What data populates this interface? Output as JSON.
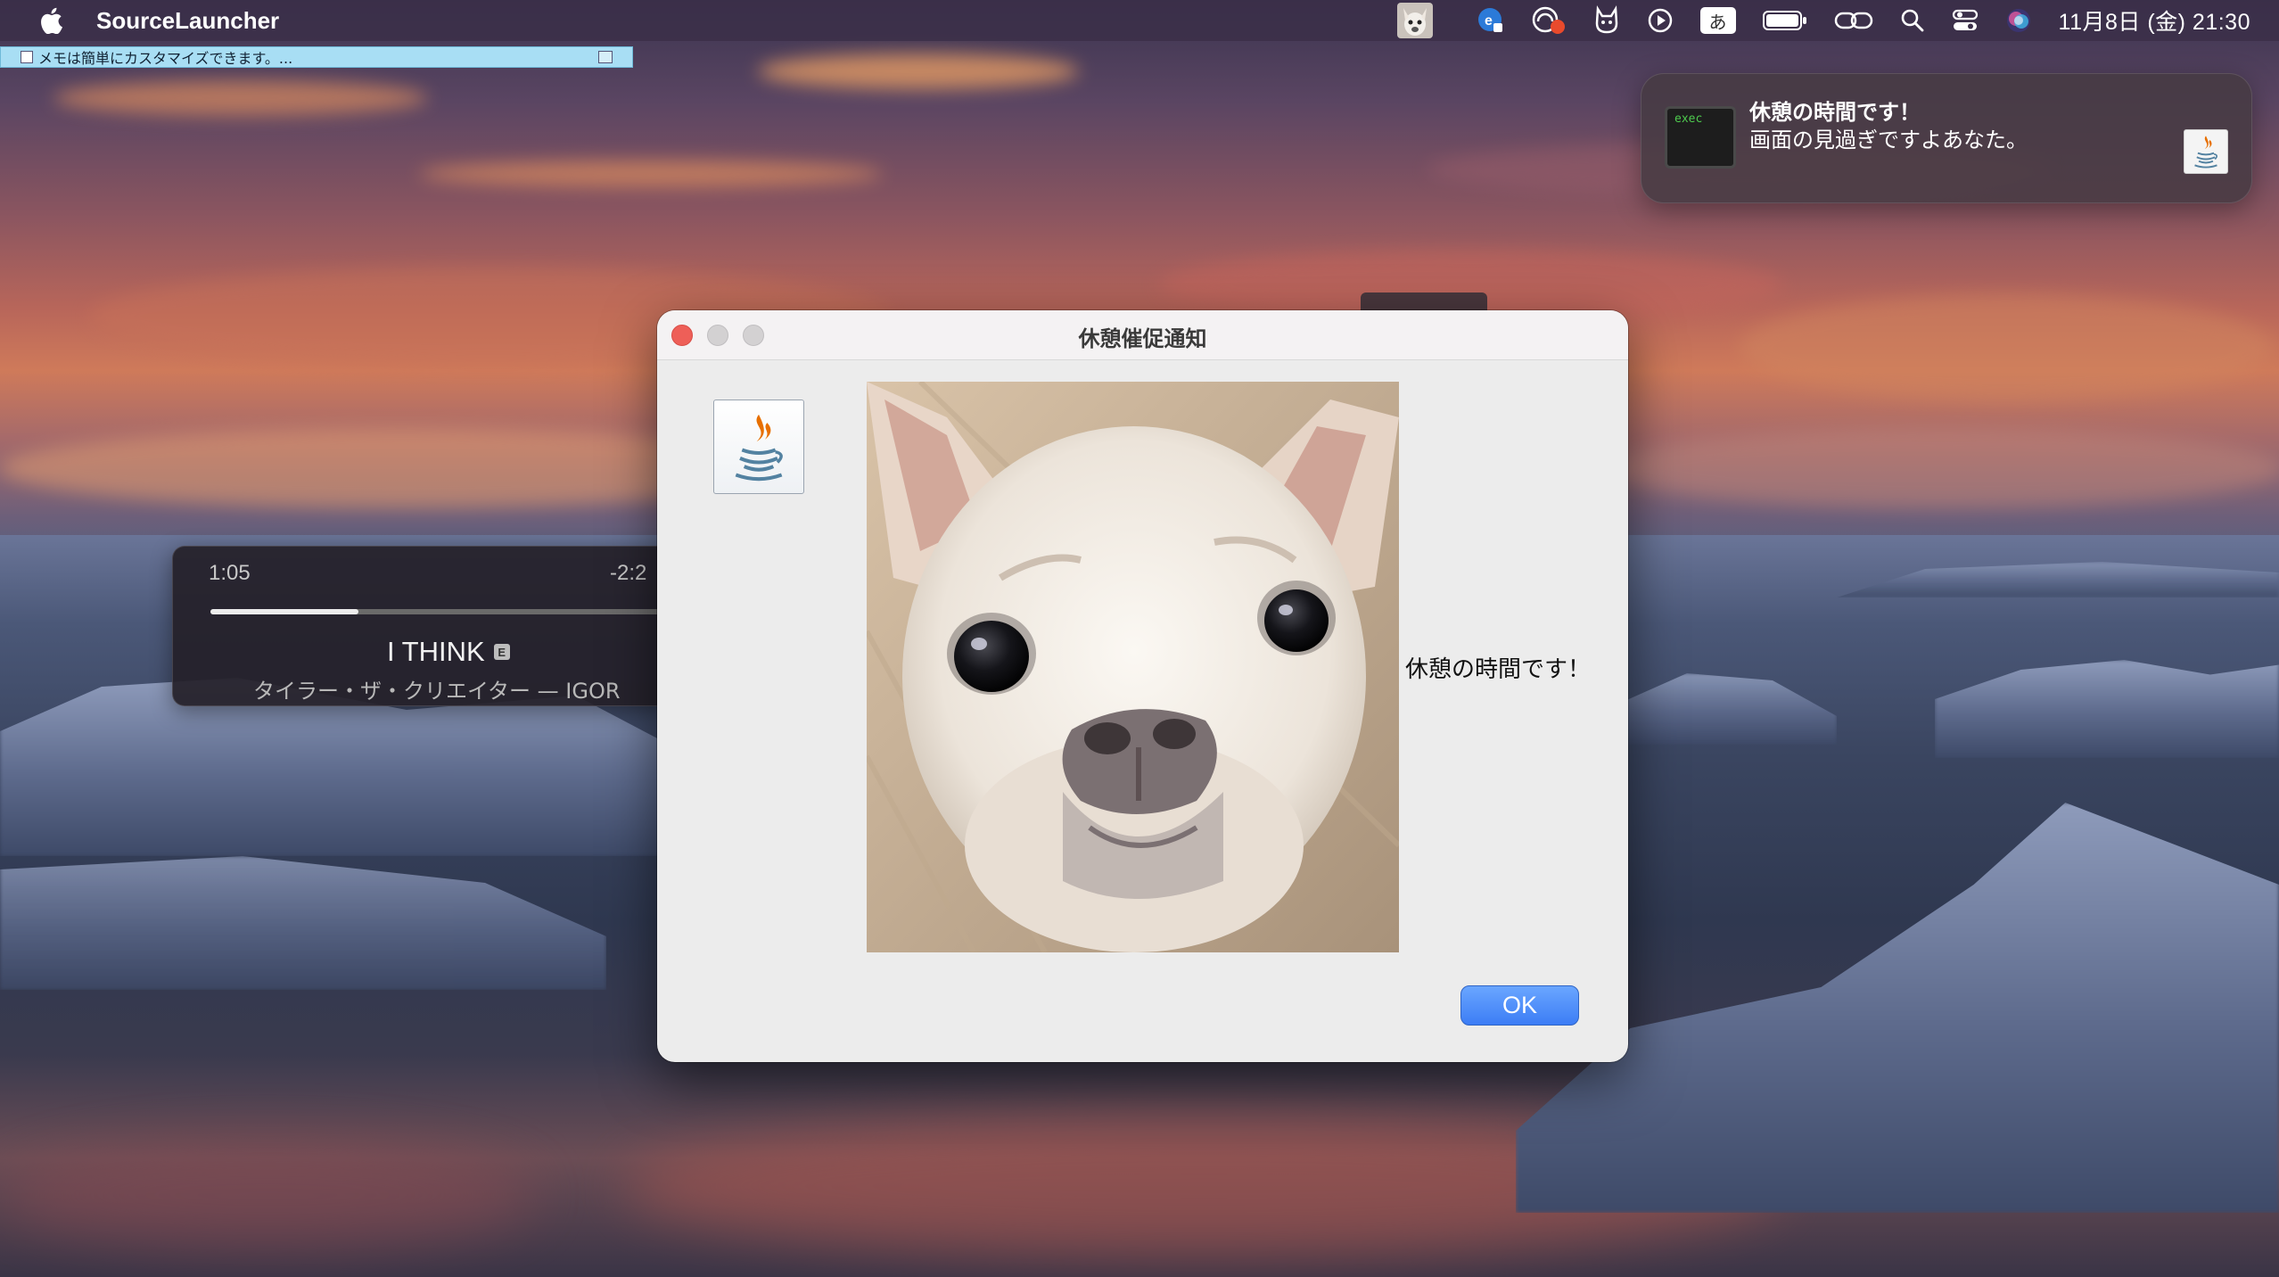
{
  "menubar": {
    "app_name": "SourceLauncher",
    "input_mode": "あ",
    "clock": "11月8日 (金)  21:30"
  },
  "memo": {
    "text": "メモは簡単にカスタマイズできます。..."
  },
  "notification": {
    "app_icon_label": "exec",
    "title": "休憩の時間です！",
    "body": "画面の見過ぎですよあなた。"
  },
  "music": {
    "elapsed": "1:05",
    "remaining": "-2:2",
    "progress_percent": 32,
    "title": "I THINK",
    "explicit_badge": "E",
    "artist_album": "タイラー・ザ・クリエイター — IGOR"
  },
  "dialog": {
    "title": "休憩催促通知",
    "message": "休憩の時間です！",
    "ok_label": "OK"
  },
  "colors": {
    "close_button": "#ee5f58",
    "ok_button": "#3c7df5",
    "memo_strip": "#a8def4"
  }
}
